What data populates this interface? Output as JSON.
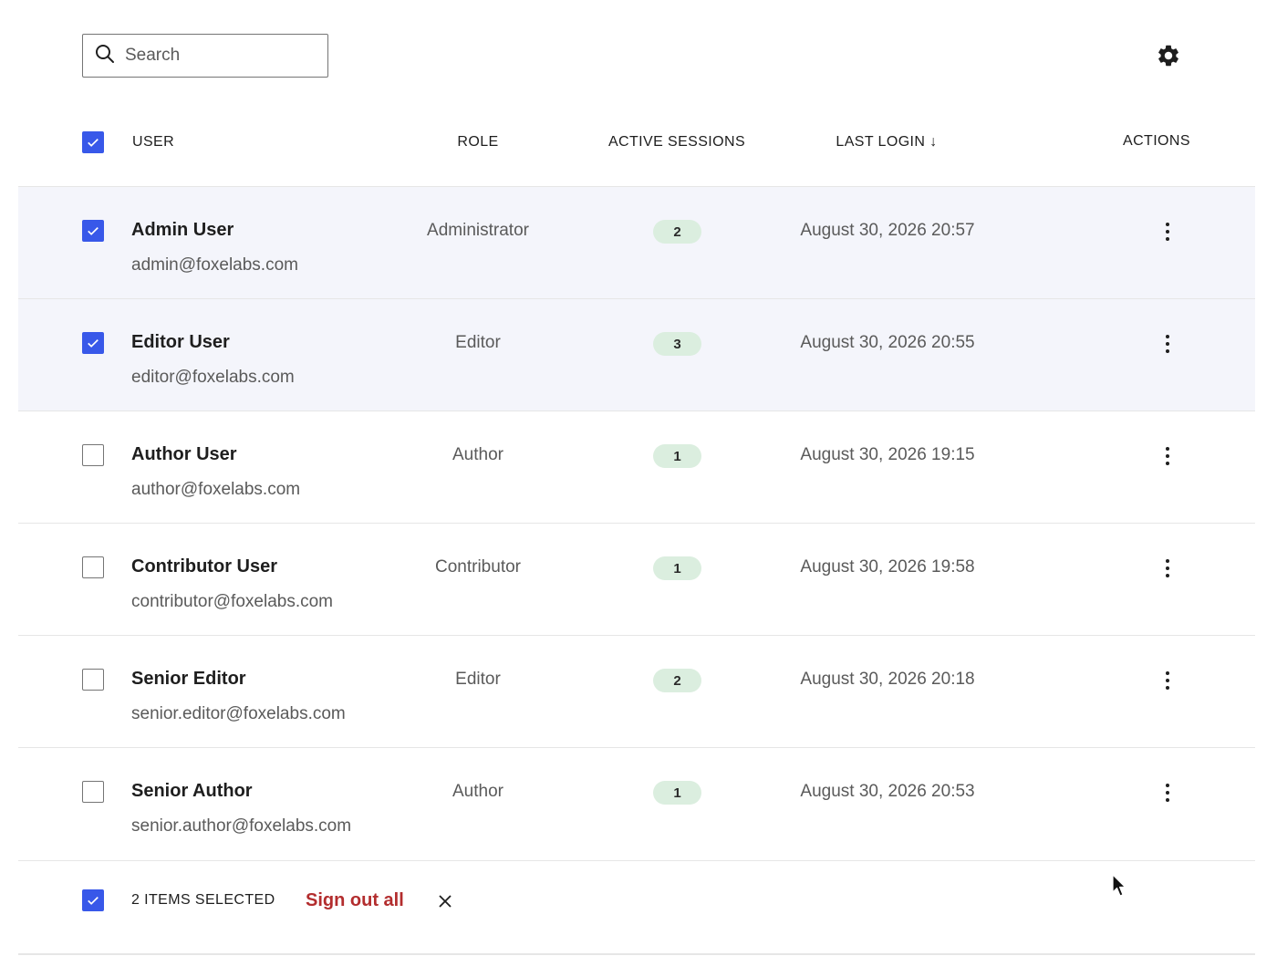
{
  "search": {
    "placeholder": "Search",
    "value": ""
  },
  "icons": {
    "search": "search-icon",
    "settings": "gear-icon",
    "actions": "more-vertical-icon",
    "close": "close-icon"
  },
  "colors": {
    "accent": "#3858e9",
    "badge_bg": "#dbeedf",
    "danger": "#b32d2e",
    "selected_row_bg": "#f4f5fb"
  },
  "table": {
    "headers": {
      "user": "USER",
      "role": "ROLE",
      "sessions": "ACTIVE SESSIONS",
      "last_login": "LAST LOGIN ↓",
      "actions": "ACTIONS"
    },
    "all_selected": true,
    "rows": [
      {
        "name": "Admin User",
        "email": "admin@foxelabs.com",
        "role": "Administrator",
        "sessions": "2",
        "last_login": "August 30, 2026 20:57",
        "selected": true
      },
      {
        "name": "Editor User",
        "email": "editor@foxelabs.com",
        "role": "Editor",
        "sessions": "3",
        "last_login": "August 30, 2026 20:55",
        "selected": true
      },
      {
        "name": "Author User",
        "email": "author@foxelabs.com",
        "role": "Author",
        "sessions": "1",
        "last_login": "August 30, 2026 19:15",
        "selected": false
      },
      {
        "name": "Contributor User",
        "email": "contributor@foxelabs.com",
        "role": "Contributor",
        "sessions": "1",
        "last_login": "August 30, 2026 19:58",
        "selected": false
      },
      {
        "name": "Senior Editor",
        "email": "senior.editor@foxelabs.com",
        "role": "Editor",
        "sessions": "2",
        "last_login": "August 30, 2026 20:18",
        "selected": false
      },
      {
        "name": "Senior Author",
        "email": "senior.author@foxelabs.com",
        "role": "Author",
        "sessions": "1",
        "last_login": "August 30, 2026 20:53",
        "selected": false
      }
    ]
  },
  "bulk": {
    "selected_label": "2 ITEMS SELECTED",
    "action_label": "Sign out all"
  }
}
